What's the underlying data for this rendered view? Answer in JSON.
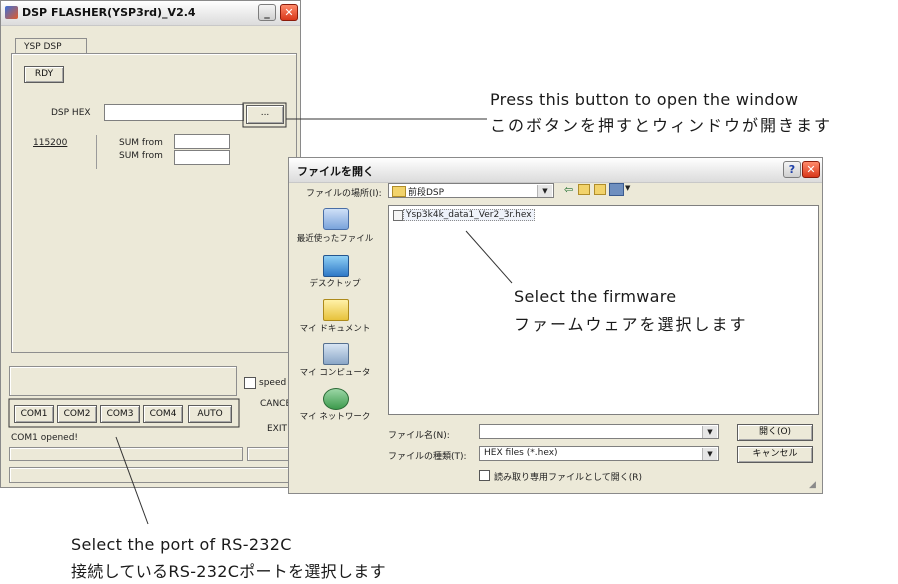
{
  "flasher": {
    "title": "DSP FLASHER(YSP3rd)_V2.4",
    "tab": "YSP DSP",
    "rdy_button": "RDY",
    "dsp_hex_label": "DSP HEX",
    "browse_button": "...",
    "baud": "115200",
    "sum_from_1": "SUM from",
    "sum_from_2": "SUM from",
    "speed_label": "speed",
    "cancel_button": "CANCE",
    "exit_button": "EXIT",
    "com_buttons": [
      "COM1",
      "COM2",
      "COM3",
      "COM4",
      "AUTO"
    ],
    "status": "COM1 opened!"
  },
  "dialog": {
    "title": "ファイルを開く",
    "look_in_label": "ファイルの場所(I):",
    "look_in_value": "前段DSP",
    "file_item": "Ysp3k4k_data1_Ver2_3r.hex",
    "places": [
      "最近使ったファイル",
      "デスクトップ",
      "マイ ドキュメント",
      "マイ コンピュータ",
      "マイ ネットワーク"
    ],
    "filename_label": "ファイル名(N):",
    "filetype_label": "ファイルの種類(T):",
    "filetype_value": "HEX files (*.hex)",
    "readonly_label": "読み取り専用ファイルとして開く(R)",
    "open_button": "開く(O)",
    "cancel_button": "キャンセル"
  },
  "annotations": {
    "button_en": "Press this button to open the window",
    "button_jp": "このボタンを押すとウィンドウが開きます",
    "firmware_en": "Select the firmware",
    "firmware_jp": "ファームウェアを選択します",
    "port_en": "Select the port of RS-232C",
    "port_jp": "接続しているRS-232Cポートを選択します"
  }
}
